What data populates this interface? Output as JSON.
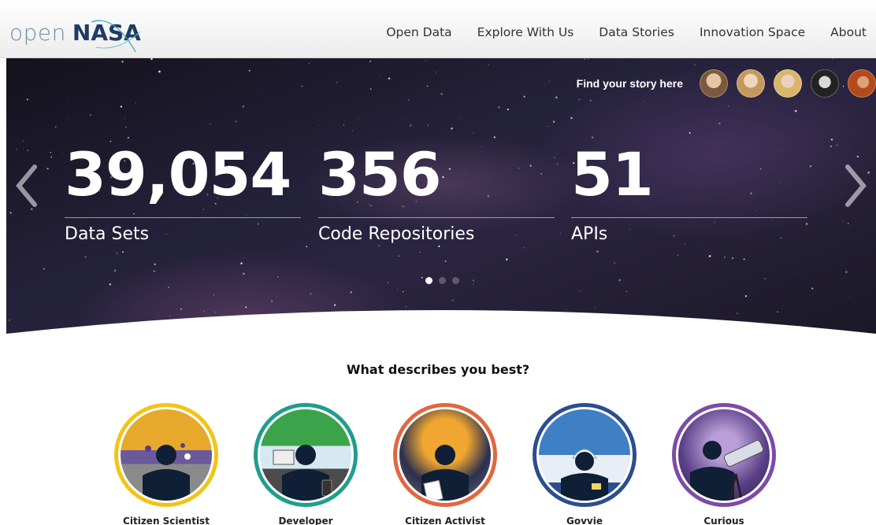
{
  "header": {
    "logo_open": "open",
    "logo_nasa": "NASA",
    "nav": [
      "Open Data",
      "Explore With Us",
      "Data Stories",
      "Innovation Space",
      "About"
    ]
  },
  "hero": {
    "story_label": "Find your story here",
    "stats": [
      {
        "value": "39,054",
        "label": "Data Sets"
      },
      {
        "value": "356",
        "label": "Code Repositories"
      },
      {
        "value": "51",
        "label": "APIs"
      }
    ],
    "slide_count": 3,
    "active_slide": 1
  },
  "personas": {
    "question": "What describes you best?",
    "items": [
      {
        "label": "Citizen Scientist",
        "ring": "#f2c417"
      },
      {
        "label": "Developer",
        "ring": "#1f9e8c"
      },
      {
        "label": "Citizen Activist",
        "ring": "#e0683f"
      },
      {
        "label": "Govvie",
        "ring": "#2c4d8e"
      },
      {
        "label": "Curious",
        "ring": "#7c4ba8"
      }
    ]
  },
  "colors": {
    "nasa_blue": "#1f3b63",
    "open_gray": "#6f8fa6"
  }
}
